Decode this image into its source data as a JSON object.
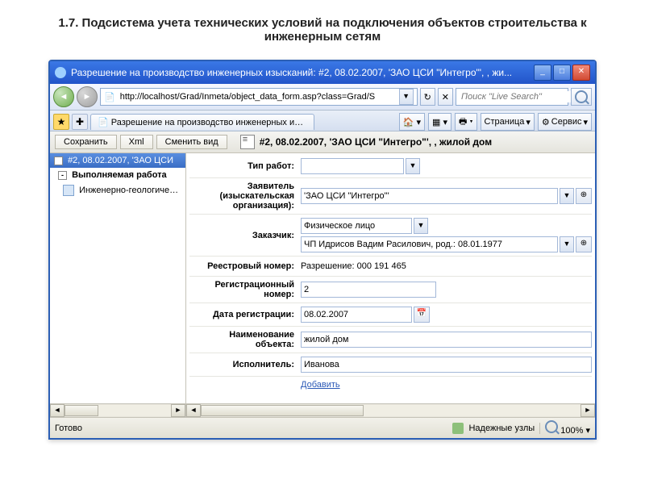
{
  "page_heading": "1.7. Подсистема учета технических условий на подключения объектов строительства к инженерным сетям",
  "window_title": "Разрешение на производство инженерных изысканий: #2, 08.02.2007, 'ЗАО ЦСИ \"Интегро\"', , жи...",
  "url": "http://localhost/Grad/Inmeta/object_data_form.asp?class=Grad/S",
  "search_placeholder": "Поиск \"Live Search\"",
  "tab_label": "Разрешение на производство инженерных изыска...",
  "ie_toolbar": {
    "home": "Домой",
    "page": "Страница",
    "tools": "Сервис"
  },
  "app_buttons": {
    "save": "Сохранить",
    "xml": "Xml",
    "change_view": "Сменить вид"
  },
  "doc_title": "#2, 08.02.2007, 'ЗАО ЦСИ \"Интегро\"', , жилой дом",
  "tree": {
    "header": "#2, 08.02.2007, 'ЗАО ЦСИ",
    "item1": "Выполняемая работа",
    "item2": "Инженерно-геологические"
  },
  "form": {
    "work_type_label": "Тип работ:",
    "work_type_value": "",
    "applicant_label": "Заявитель (изыскательская организация):",
    "applicant_value": "'ЗАО ЦСИ \"Интегро\"'",
    "customer_label": "Заказчик:",
    "customer_value": "Физическое лицо",
    "customer_person": "ЧП Идрисов Вадим Расилович, род.: 08.01.1977",
    "reg_number_label": "Реестровый номер:",
    "reg_number_value": "Разрешение: 000 191 465",
    "registration_label": "Регистрационный номер:",
    "registration_value": "2",
    "reg_date_label": "Дата регистрации:",
    "reg_date_value": "08.02.2007",
    "object_name_label": "Наименование объекта:",
    "object_name_value": "жилой дом",
    "executor_label": "Исполнитель:",
    "executor_value": "Иванова",
    "add_link": "Добавить"
  },
  "status": {
    "ready": "Готово",
    "trusted": "Надежные узлы",
    "zoom": "100%"
  }
}
